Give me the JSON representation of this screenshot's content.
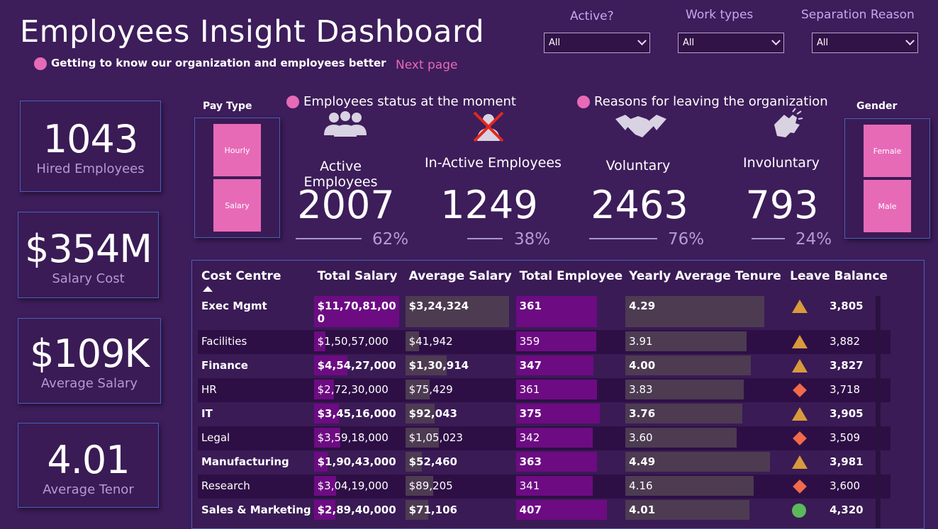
{
  "header": {
    "title": "Employees Insight Dashboard",
    "subtitle": "Getting to know our organization and employees better",
    "next_page": "Next page"
  },
  "filters": [
    {
      "label": "Active?",
      "value": "All"
    },
    {
      "label": "Work types",
      "value": "All"
    },
    {
      "label": "Separation Reason",
      "value": "All"
    }
  ],
  "cards": [
    {
      "value": "1043",
      "label": "Hired Employees"
    },
    {
      "value": "$354M",
      "label": "Salary Cost"
    },
    {
      "value": "$109K",
      "label": "Average Salary"
    },
    {
      "value": "4.01",
      "label": "Average Tenor"
    }
  ],
  "pay_type": {
    "title": "Pay Type",
    "options": [
      "Hourly",
      "Salary"
    ]
  },
  "gender": {
    "title": "Gender",
    "options": [
      "Female",
      "Male"
    ]
  },
  "sections": {
    "status": "Employees status at the moment",
    "reasons": "Reasons for leaving the organization"
  },
  "kpis": [
    {
      "label": "Active Employees",
      "value": "2007",
      "pct": "62%",
      "icon": "people-group-icon"
    },
    {
      "label": "In-Active Employees",
      "value": "1249",
      "pct": "38%",
      "icon": "user-crossed-icon"
    },
    {
      "label": "Voluntary",
      "value": "2463",
      "pct": "76%",
      "icon": "handshake-icon"
    },
    {
      "label": "Involuntary",
      "value": "793",
      "pct": "24%",
      "icon": "clapping-hands-icon"
    }
  ],
  "colors": {
    "background": "#3d1d5a",
    "accent": "#e76ab7",
    "bar_purple": "#6d0b83",
    "bar_grey": "#4d3b52",
    "triangle": "#d99a3c",
    "diamond": "#f06a4b",
    "circle": "#5bb85c"
  },
  "table": {
    "columns": [
      "Cost Centre",
      "Total Salary",
      "Average Salary",
      "Total Employee",
      "Yearly Average Tenure",
      "Leave Balance"
    ],
    "rows": [
      {
        "cc": "Exec Mgmt",
        "ts": "$11,70,81,00",
        "ts2": "0",
        "as": "$3,24,324",
        "te": "361",
        "tn": "4.29",
        "ind": "triangle",
        "lb": "3,805",
        "tsf": 1.0,
        "asf": 1.0,
        "tef": 0.89,
        "tnf": 0.95
      },
      {
        "cc": "Facilities",
        "ts": "$1,50,57,000",
        "as": "$41,942",
        "te": "359",
        "tn": "3.91",
        "ind": "triangle",
        "lb": "3,882",
        "tsf": 0.13,
        "asf": 0.13,
        "tef": 0.88,
        "tnf": 0.83
      },
      {
        "cc": "Finance",
        "ts": "$4,54,27,000",
        "as": "$1,30,914",
        "te": "347",
        "tn": "4.00",
        "ind": "triangle",
        "lb": "3,827",
        "tsf": 0.39,
        "asf": 0.4,
        "tef": 0.85,
        "tnf": 0.86
      },
      {
        "cc": "HR",
        "ts": "$2,72,30,000",
        "as": "$75,429",
        "te": "361",
        "tn": "3.83",
        "ind": "diamond",
        "lb": "3,718",
        "tsf": 0.23,
        "asf": 0.23,
        "tef": 0.89,
        "tnf": 0.81
      },
      {
        "cc": "IT",
        "ts": "$3,45,16,000",
        "as": "$92,043",
        "te": "375",
        "tn": "3.76",
        "ind": "triangle",
        "lb": "3,905",
        "tsf": 0.29,
        "asf": 0.28,
        "tef": 0.92,
        "tnf": 0.8
      },
      {
        "cc": "Legal",
        "ts": "$3,59,18,000",
        "as": "$1,05,023",
        "te": "342",
        "tn": "3.60",
        "ind": "diamond",
        "lb": "3,509",
        "tsf": 0.31,
        "asf": 0.32,
        "tef": 0.84,
        "tnf": 0.76
      },
      {
        "cc": "Manufacturing",
        "ts": "$1,90,43,000",
        "as": "$52,460",
        "te": "363",
        "tn": "4.49",
        "ind": "triangle",
        "lb": "3,981",
        "tsf": 0.16,
        "asf": 0.16,
        "tef": 0.89,
        "tnf": 0.99
      },
      {
        "cc": "Research",
        "ts": "$3,04,19,000",
        "as": "$89,205",
        "te": "341",
        "tn": "4.16",
        "ind": "diamond",
        "lb": "3,600",
        "tsf": 0.26,
        "asf": 0.27,
        "tef": 0.84,
        "tnf": 0.88
      },
      {
        "cc": "Sales & Marketing",
        "ts": "$2,89,40,000",
        "as": "$71,106",
        "te": "407",
        "tn": "4.01",
        "ind": "circle",
        "lb": "4,320",
        "tsf": 0.25,
        "asf": 0.22,
        "tef": 1.0,
        "tnf": 0.85
      }
    ]
  }
}
